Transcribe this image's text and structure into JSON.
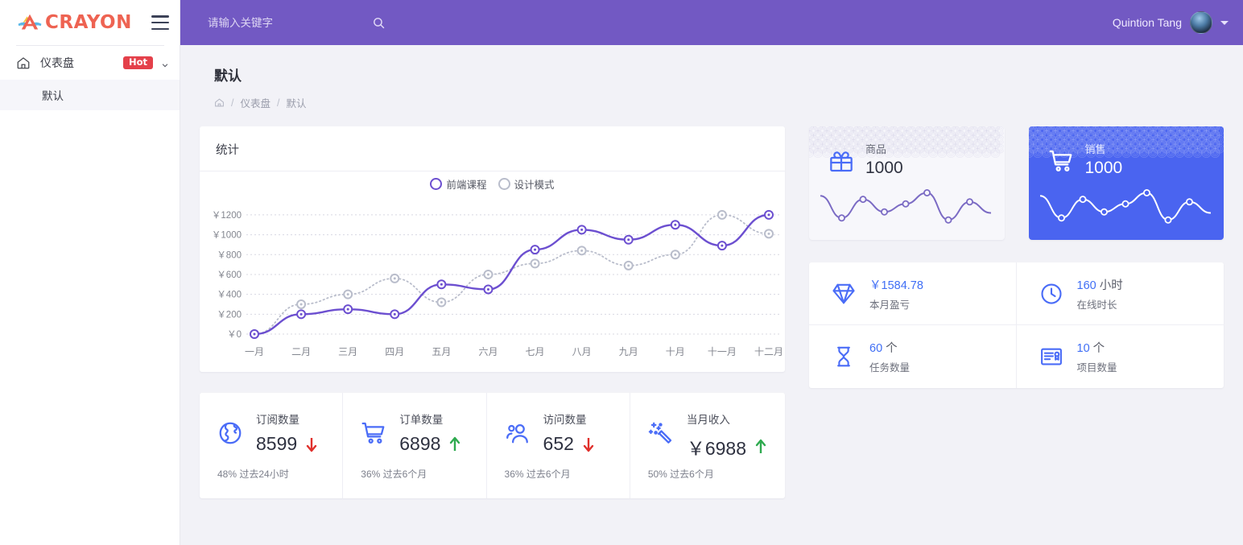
{
  "brand": {
    "name": "CRAYON",
    "menu_icon": "hamburger-icon"
  },
  "sidebar": {
    "items": [
      {
        "label": "仪表盘",
        "icon": "home-icon",
        "badge": "Hot",
        "expanded": true,
        "children": [
          {
            "label": "默认",
            "active": true
          }
        ]
      }
    ]
  },
  "topbar": {
    "search": {
      "placeholder": "请输入关键字",
      "value": "",
      "icon": "search-icon"
    },
    "user": {
      "name": "Quintion Tang",
      "avatar": "avatar-image",
      "caret": "chevron-down-icon"
    },
    "bg_color": "#7259c3"
  },
  "page": {
    "title": "默认",
    "breadcrumb": [
      {
        "label": "",
        "icon": "home-icon"
      },
      {
        "label": "仪表盘"
      },
      {
        "label": "默认"
      }
    ],
    "breadcrumb_separator": "/"
  },
  "stats_card": {
    "title": "统计"
  },
  "chart_data": {
    "type": "line",
    "title": "统计",
    "xlabel": "",
    "ylabel": "",
    "categories": [
      "一月",
      "二月",
      "三月",
      "四月",
      "五月",
      "六月",
      "七月",
      "八月",
      "九月",
      "十月",
      "十一月",
      "十二月"
    ],
    "ytick_labels": [
      "￥0",
      "￥200",
      "￥400",
      "￥600",
      "￥800",
      "￥1000",
      "￥1200"
    ],
    "ytick_values": [
      0,
      200,
      400,
      600,
      800,
      1000,
      1200
    ],
    "ylim": [
      0,
      1280
    ],
    "grid": true,
    "legend_position": "top-center",
    "series": [
      {
        "name": "前端课程",
        "color": "#6c4fd0",
        "style": "solid",
        "values": [
          0,
          200,
          250,
          200,
          500,
          450,
          850,
          1050,
          950,
          1100,
          890,
          1200
        ]
      },
      {
        "name": "设计模式",
        "color": "#b9bdcb",
        "style": "dotted",
        "values": [
          0,
          300,
          400,
          560,
          320,
          600,
          710,
          840,
          690,
          800,
          1200,
          1010
        ]
      }
    ]
  },
  "hero_cards": [
    {
      "label": "商品",
      "value": "1000",
      "icon": "gift-icon",
      "theme": "light",
      "spark": [
        62,
        18,
        55,
        30,
        46,
        68,
        14,
        50,
        28
      ]
    },
    {
      "label": "销售",
      "value": "1000",
      "icon": "shopping-cart-icon",
      "theme": "blue",
      "spark": [
        62,
        18,
        55,
        30,
        46,
        68,
        14,
        50,
        28
      ]
    }
  ],
  "metrics": [
    {
      "value": "￥1584.78",
      "unit": "",
      "label": "本月盈亏",
      "icon": "diamond-icon"
    },
    {
      "value": "160",
      "unit": "小时",
      "label": "在线时长",
      "icon": "clock-icon"
    },
    {
      "value": "60",
      "unit": "个",
      "label": "任务数量",
      "icon": "hourglass-icon"
    },
    {
      "value": "10",
      "unit": "个",
      "label": "项目数量",
      "icon": "certificate-icon"
    }
  ],
  "bottom_stats": [
    {
      "label": "订阅数量",
      "value": "8599",
      "trend": "down",
      "footer": "48% 过去24小时",
      "icon": "globe-icon"
    },
    {
      "label": "订单数量",
      "value": "6898",
      "trend": "up",
      "footer": "36% 过去6个月",
      "icon": "shopping-cart-icon"
    },
    {
      "label": "访问数量",
      "value": "652",
      "trend": "down",
      "footer": "36% 过去6个月",
      "icon": "users-icon"
    },
    {
      "label": "当月收入",
      "value": "￥6988",
      "trend": "up",
      "footer": "50% 过去6个月",
      "icon": "magic-wand-icon"
    }
  ],
  "colors": {
    "header": "#7259c3",
    "accent_blue": "#4a6cf7",
    "hero_blue": "#4a64f0",
    "chart_purple": "#6c4fd0",
    "chart_gray": "#b9bdcb",
    "trend_up": "#2eaa4f",
    "trend_down": "#e0302c",
    "badge_red": "#e4404a",
    "brand_red": "#ee6352",
    "page_bg": "#f2f2f7"
  }
}
